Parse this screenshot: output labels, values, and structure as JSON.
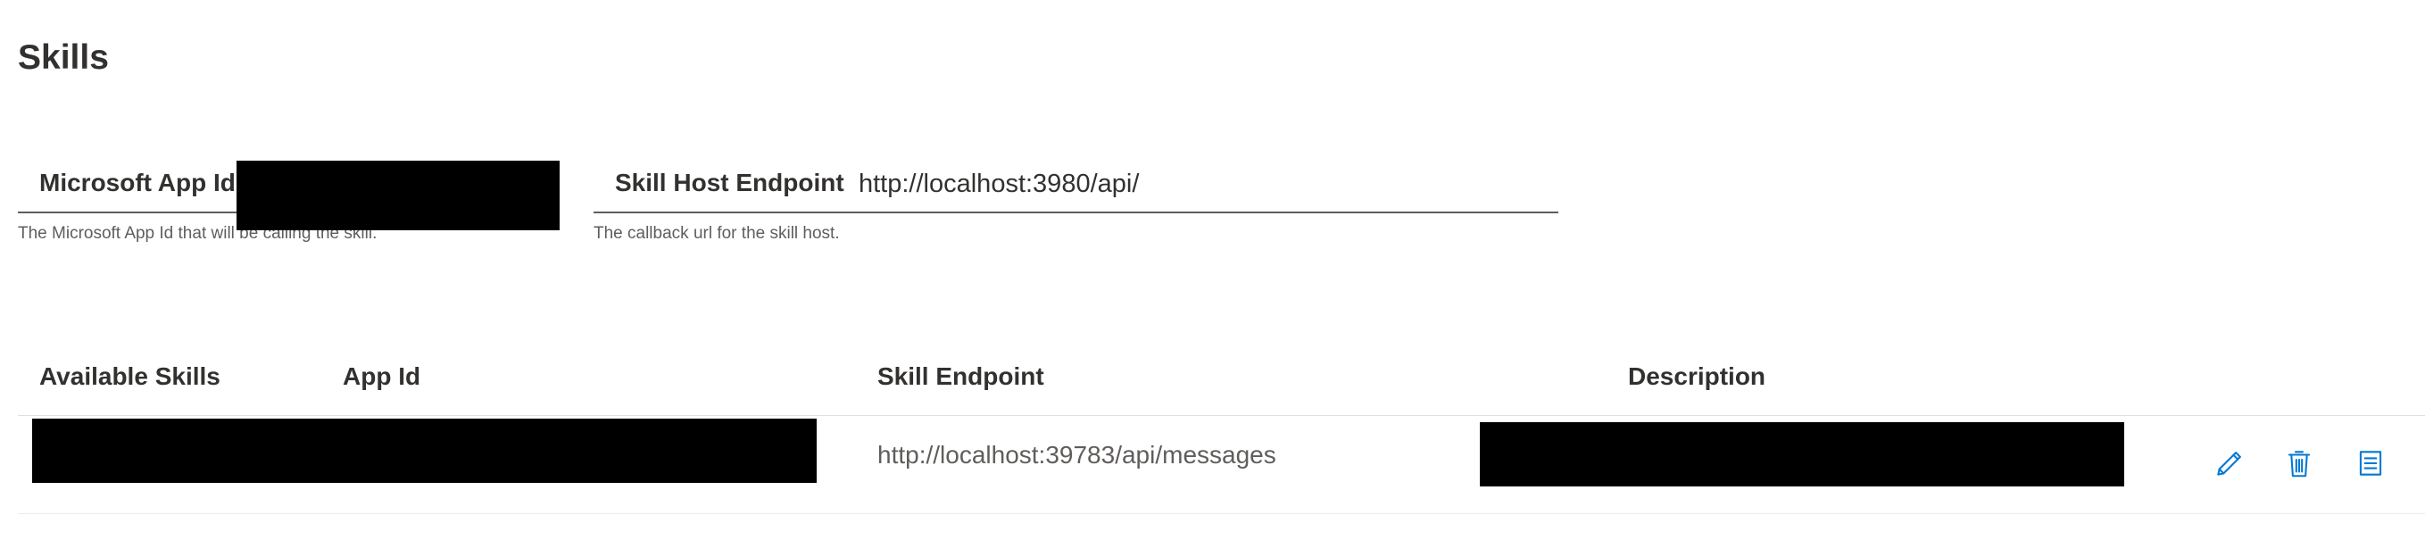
{
  "page": {
    "title": "Skills"
  },
  "settings": {
    "app_id": {
      "label": "Microsoft App Id",
      "value": "",
      "hint": "The Microsoft App Id that will be calling the skill."
    },
    "skill_host_endpoint": {
      "label": "Skill Host Endpoint",
      "value": "http://localhost:3980/api/",
      "hint": "The callback url for the skill host."
    }
  },
  "table": {
    "columns": [
      "Available Skills",
      "App Id",
      "Skill Endpoint",
      "Description"
    ],
    "rows": [
      {
        "name": "",
        "app_id": "",
        "endpoint": "http://localhost:39783/api/messages",
        "description": ""
      }
    ]
  },
  "icons": {
    "edit": "pencil-icon",
    "delete": "trash-icon",
    "manifest": "document-icon"
  },
  "colors": {
    "accent": "#0078d4",
    "text": "#323130",
    "secondary_text": "#605e5c",
    "redaction": "#000000"
  }
}
